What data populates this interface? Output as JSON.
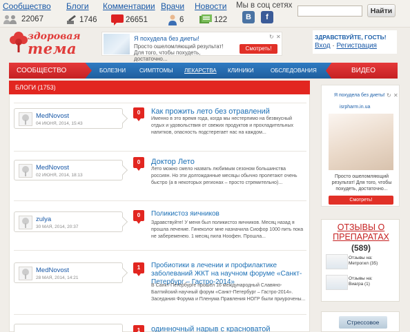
{
  "topnav": [
    {
      "label": "Сообщество",
      "icon": "people-icon",
      "count": "22067"
    },
    {
      "label": "Блоги",
      "icon": "pencil-icon",
      "count": "1746"
    },
    {
      "label": "Комментарии",
      "icon": "comment-icon",
      "count": "26651"
    },
    {
      "label": "Врачи",
      "icon": "doctor-icon",
      "count": "6"
    },
    {
      "label": "Новости",
      "icon": "news-icon",
      "count": "122"
    }
  ],
  "social": {
    "label": "Мы в соц сетях",
    "vk": "В",
    "fb": "f"
  },
  "search": {
    "placeholder": "",
    "button": "Найти"
  },
  "logo": {
    "line1": "здоровая",
    "line2": "тема"
  },
  "ad": {
    "title": "Я похудела без диеты!",
    "text": "Просто ошеломляющий результат! Для того, чтобы похудеть, достаточно...",
    "button": "Смотреть!"
  },
  "welcome": {
    "title": "ЗДРАВСТВУЙТЕ, ГОСТЬ!",
    "login": "Вход",
    "sep": " · ",
    "register": "Регистрация"
  },
  "menu": [
    "Сообщество",
    "Болезни",
    "Симптомы",
    "Лекарства",
    "Клиники",
    "Обследования",
    "Видео"
  ],
  "blogs_header": "БЛОГИ (1753)",
  "entries": [
    {
      "author": "MedNovost",
      "date": "04 июня, 2014, 15:43",
      "comments": "0",
      "title": "Как прожить лето без отравлений",
      "excerpt": "Именно в это время года, когда мы нестерпимо на безвкусный отдых и удовольствия от свежих продуктов и прохладительных напитков, опасность подстерегает нас на каждом..."
    },
    {
      "author": "MedNovost",
      "date": "02 июня, 2014, 18:13",
      "comments": "0",
      "title": "Доктор Лето",
      "excerpt": "Лето можно смело назвать любимым сезоном большинства россиян. Но эти долгожданные месяцы обычно пролетают очень быстро (а в некоторых регионах – просто стремительно)..."
    },
    {
      "author": "zulya",
      "date": "30 мая, 2014, 20:37",
      "comments": "0",
      "title": "Поликистоз яичников",
      "excerpt": "Здравствуйте! У меня был поликистоз яичников. Месяц назад я прошла лечение. Гинеколог мне назначила Сиофор 1000 пить пока не забеременею. 1 месяц пила Ноофен. Прошла..."
    },
    {
      "author": "MedNovost",
      "date": "28 мая, 2014, 14:21",
      "comments": "1",
      "title": "Пробиотики в лечении и профилактике заболеваний ЖКТ на научном форуме «Санкт-Петербург – Гастро-2014»",
      "excerpt": "В Санкт-Петербурге прошел 16 международный Славяно-Балтийский научный форум «Санкт-Петербург – Гастро-2014». Заседания Форума и Пленума Правления НОГР были приурочены..."
    },
    {
      "author": "",
      "date": "",
      "comments": "1",
      "title": "одинночный нарыв с красноватой",
      "excerpt": ""
    }
  ],
  "sidebar_ad": {
    "title": "Я похудела без диеты!",
    "source": "isrpharm.in.ua",
    "text": "Просто ошеломляющий результат! Для того, чтобы похудеть, достаточно...",
    "button": "Смотреть!"
  },
  "reviews": {
    "heading": "Отзывы о препаратах",
    "count": "(589)",
    "items": [
      {
        "l1": "Отзывы на:",
        "l2": "Метрогил (35)"
      },
      {
        "l1": "Отзывы на:",
        "l2": "Виагра (1)"
      }
    ]
  },
  "sidebar_box2": "Стрессовое",
  "colors": {
    "red": "#e22620",
    "blue": "#1f5e9e",
    "link": "#1757a6"
  }
}
